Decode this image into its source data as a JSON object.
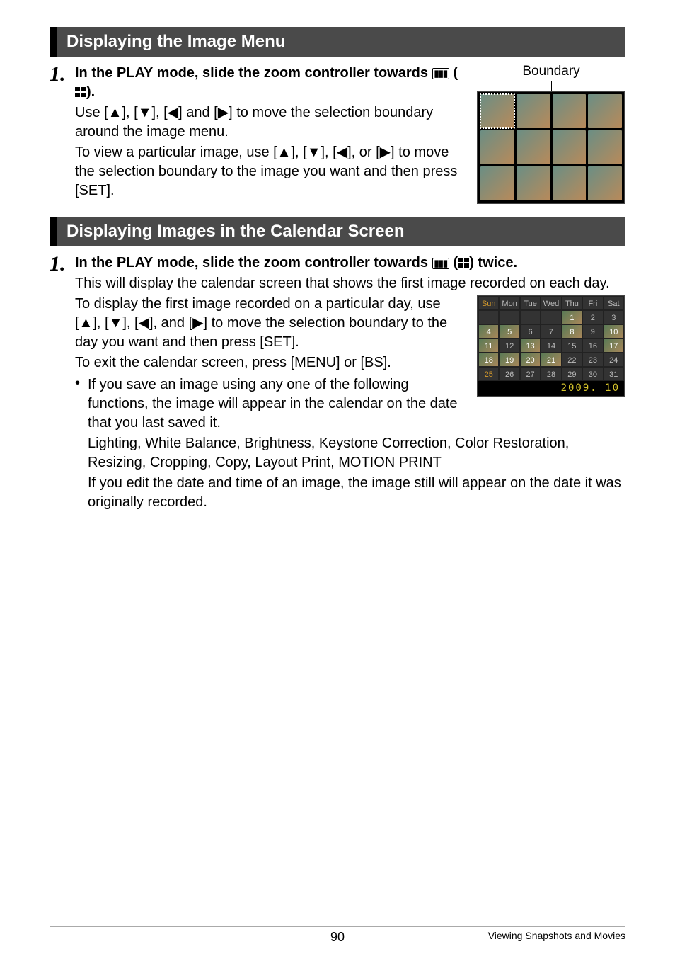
{
  "section1": {
    "header": "Displaying the Image Menu",
    "boundary_label": "Boundary",
    "step_num": "1.",
    "title_a": "In the PLAY mode, slide the zoom controller towards ",
    "title_b": " (",
    "title_c": ").",
    "desc1": "Use [▲], [▼], [◀] and [▶] to move the selection boundary around the image menu.",
    "desc2": "To view a particular image, use [▲], [▼], [◀], or [▶] to move the selection boundary to the image you want and then press [SET]."
  },
  "section2": {
    "header": "Displaying Images in the Calendar Screen",
    "step_num": "1.",
    "title_a": "In the PLAY mode, slide the zoom controller towards ",
    "title_b": " (",
    "title_c": ") twice.",
    "desc1": "This will display the calendar screen that shows the first image recorded on each day.",
    "desc2": "To display the first image recorded on a particular day, use [▲], [▼], [◀], and [▶] to move the selection boundary to the day you want and then press [SET].",
    "desc3": "To exit the calendar screen, press [MENU] or [BS].",
    "bullet": "If you save an image using any one of the following functions, the image will appear in the calendar on the date that you last saved it.",
    "bullet_sub1": "Lighting, White Balance, Brightness, Keystone Correction, Color Restoration, Resizing, Cropping, Copy, Layout Print, MOTION PRINT",
    "bullet_sub2": "If you edit the date and time of an image, the image still will appear on the date it was originally recorded."
  },
  "calendar": {
    "days": [
      "Sun",
      "Mon",
      "Tue",
      "Wed",
      "Thu",
      "Fri",
      "Sat"
    ],
    "footer": "2009. 10"
  },
  "footer": {
    "page_num": "90",
    "right": "Viewing Snapshots and Movies"
  },
  "icon": {
    "zoom_out": "▮▮▮"
  }
}
